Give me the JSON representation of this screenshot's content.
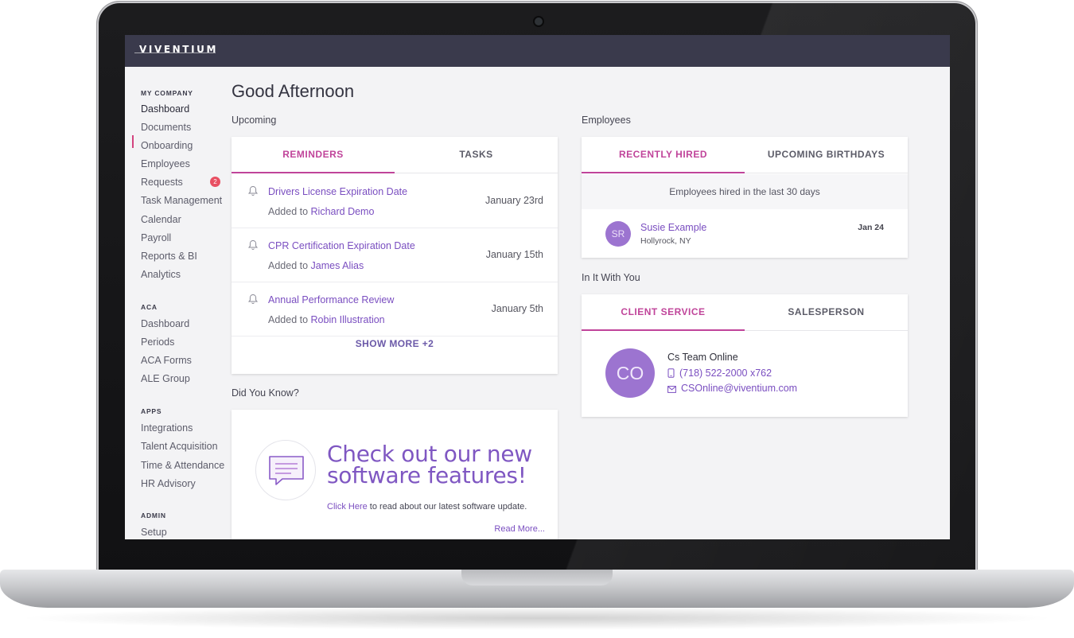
{
  "app": {
    "logo_text": "VIVENTIUM"
  },
  "sidebar": {
    "sections": [
      {
        "heading": "MY COMPANY",
        "items": [
          "Dashboard",
          "Documents",
          "Onboarding",
          "Employees",
          "Requests",
          "Task Management",
          "Calendar",
          "Payroll",
          "Reports & BI",
          "Analytics"
        ]
      },
      {
        "heading": "ACA",
        "items": [
          "Dashboard",
          "Periods",
          "ACA Forms",
          "ALE Group"
        ]
      },
      {
        "heading": "APPS",
        "items": [
          "Integrations",
          "Talent Acquisition",
          "Time & Attendance",
          "HR Advisory"
        ]
      },
      {
        "heading": "ADMIN",
        "items": [
          "Setup"
        ]
      }
    ],
    "active_item": "Dashboard",
    "requests_badge": "2"
  },
  "main": {
    "greeting": "Good Afternoon",
    "upcoming": {
      "title": "Upcoming",
      "tabs": [
        "REMINDERS",
        "TASKS"
      ],
      "active_tab": "REMINDERS",
      "reminders": [
        {
          "title": "Drivers License Expiration Date",
          "added_prefix": "Added to",
          "person": "Richard Demo",
          "date": "January 23rd"
        },
        {
          "title": "CPR Certification Expiration Date",
          "added_prefix": "Added to",
          "person": "James Alias",
          "date": "January 15th"
        },
        {
          "title": "Annual Performance Review",
          "added_prefix": "Added to",
          "person": "Robin Illustration",
          "date": "January 5th"
        }
      ],
      "show_more": "SHOW MORE +2"
    },
    "did_you_know": {
      "title": "Did You Know?",
      "headline_1": "Check out our new",
      "headline_2": "software features!",
      "link_text": "Click Here",
      "body_text": "to read about our latest software update.",
      "read_more": "Read More..."
    },
    "employees": {
      "title": "Employees",
      "tabs": [
        "RECENTLY HIRED",
        "UPCOMING BIRTHDAYS"
      ],
      "active_tab": "RECENTLY HIRED",
      "note": "Employees hired in the last 30 days",
      "hires": [
        {
          "initials": "SR",
          "name": "Susie Example",
          "location": "Hollyrock, NY",
          "date": "Jan 24"
        }
      ]
    },
    "in_it_with_you": {
      "title": "In It With You",
      "tabs": [
        "CLIENT SERVICE",
        "SALESPERSON"
      ],
      "active_tab": "CLIENT SERVICE",
      "contact": {
        "initials": "CO",
        "name": "Cs Team Online",
        "phone": "(718) 522-2000 x762",
        "email": "CSOnline@viventium.com"
      }
    }
  },
  "colors": {
    "accent": "#c0449a",
    "link": "#7a4ec0",
    "topbar": "#3a3a4c",
    "avatar": "#9c74d0",
    "badge": "#e84f62"
  }
}
